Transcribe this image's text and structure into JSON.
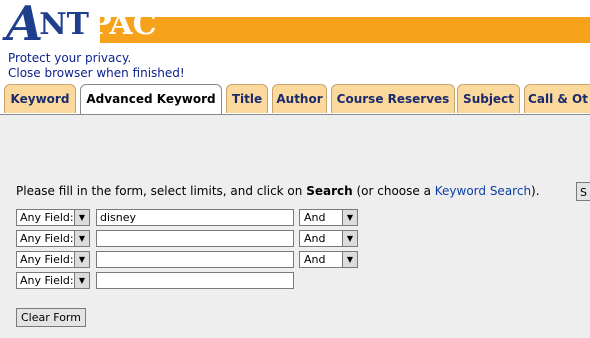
{
  "header": {
    "logo_a": "A",
    "logo_nt": "NT",
    "logo_pac": "PAC",
    "brand_color": "#1f3f8e",
    "accent_color": "#f7a21b"
  },
  "notice": {
    "line1": "Protect your privacy.",
    "line2": "Close browser when finished!"
  },
  "tabs": [
    {
      "label": "Keyword",
      "active": false
    },
    {
      "label": "Advanced Keyword",
      "active": true
    },
    {
      "label": "Title",
      "active": false
    },
    {
      "label": "Author",
      "active": false
    },
    {
      "label": "Course Reserves",
      "active": false
    },
    {
      "label": "Subject",
      "active": false
    },
    {
      "label": "Call & Ot",
      "active": false
    }
  ],
  "form": {
    "instructions_prefix": "Please fill in the form, select limits, and click on ",
    "instructions_bold": "Search",
    "instructions_mid": " (or choose a ",
    "instructions_link": "Keyword Search",
    "instructions_suffix": ").",
    "cut_button": "S",
    "rows": [
      {
        "field": "Any Field:",
        "value": "disney",
        "operator": "And"
      },
      {
        "field": "Any Field:",
        "value": "",
        "operator": "And"
      },
      {
        "field": "Any Field:",
        "value": "",
        "operator": "And"
      },
      {
        "field": "Any Field:",
        "value": ""
      }
    ],
    "dropdown_arrow": "▼",
    "clear_button": "Clear Form"
  }
}
